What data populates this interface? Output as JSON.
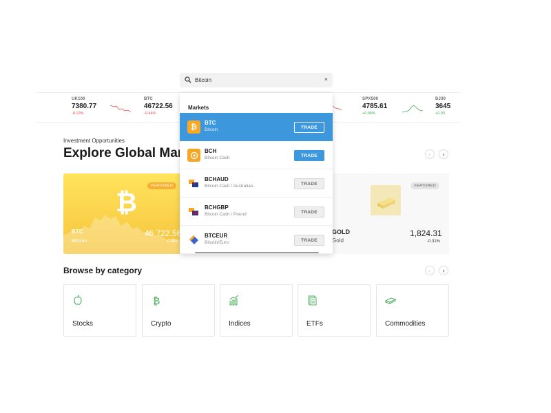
{
  "search": {
    "value": "Bitcoin",
    "clear_icon": "close-icon"
  },
  "tickers": [
    {
      "symbol": "UK100",
      "price": "7380.77",
      "change": "-0.10%",
      "direction": "down"
    },
    {
      "symbol": "BTC",
      "price": "46722.56",
      "change": "-0.44%",
      "direction": "down"
    },
    {
      "symbol": "SPX500",
      "price": "4785.61",
      "change": "+0.06%",
      "direction": "up"
    },
    {
      "symbol": "DJ30",
      "price": "3645",
      "change": "+0.03",
      "direction": "up"
    }
  ],
  "investment_label": "Investment Opportunities",
  "explore_title": "Explore Global Mark",
  "featured": [
    {
      "badge": "FEATURED",
      "symbol": "BTC",
      "name": "Bitcoin",
      "price": "46,722.56",
      "change": "-0.44%",
      "color": "#f6c33c"
    },
    {
      "badge": "FEATURED",
      "symbol": "GOLD",
      "name": "Gold",
      "price": "1,824.31",
      "change": "-0.31%"
    }
  ],
  "dropdown": {
    "section_title": "Markets",
    "results": [
      {
        "symbol": "BTC",
        "name": "Bitcoin",
        "button": "TRADE",
        "icon": "bitcoin-icon"
      },
      {
        "symbol": "BCH",
        "name": "Bitcoin Cash",
        "button": "TRADE",
        "icon": "bitcoin-cash-icon"
      },
      {
        "symbol": "BCHAUD",
        "name": "Bitcoin Cash / Australian..",
        "button": "TRADE",
        "icon": "currency-pair-icon"
      },
      {
        "symbol": "BCHGBP",
        "name": "Bitcoin Cash / Pound",
        "button": "TRADE",
        "icon": "currency-pair-icon"
      },
      {
        "symbol": "BTCEUR",
        "name": "Bitcoin/Euro",
        "button": "TRADE",
        "icon": "currency-pair-icon"
      }
    ]
  },
  "browse_title": "Browse by category",
  "categories": [
    {
      "label": "Stocks",
      "icon": "apple-icon"
    },
    {
      "label": "Crypto",
      "icon": "bitcoin-icon"
    },
    {
      "label": "Indices",
      "icon": "chart-icon"
    },
    {
      "label": "ETFs",
      "icon": "document-icon"
    },
    {
      "label": "Commodities",
      "icon": "gold-bar-icon"
    }
  ],
  "colors": {
    "accent": "#3c97dc",
    "positive": "#3aa84b",
    "negative": "#e34a4a",
    "category_icon": "#3aa84b"
  }
}
